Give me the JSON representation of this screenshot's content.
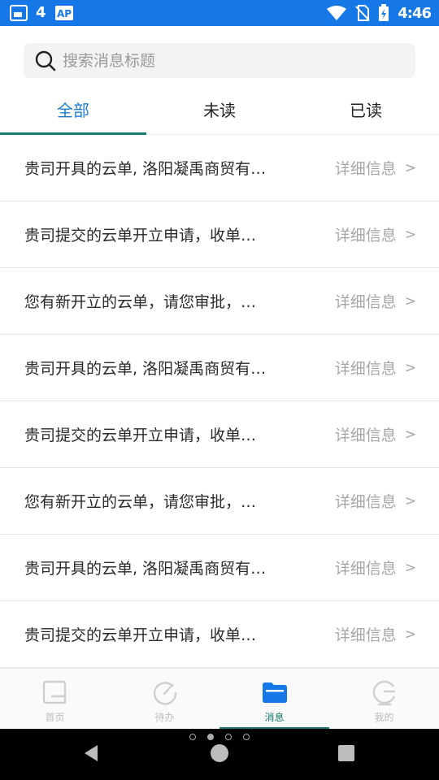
{
  "status_bar": {
    "left_number": "4",
    "time": "4:46"
  },
  "search": {
    "placeholder": "搜索消息标题"
  },
  "tabs": [
    {
      "label": "全部",
      "active": true
    },
    {
      "label": "未读",
      "active": false
    },
    {
      "label": "已读",
      "active": false
    }
  ],
  "messages": [
    {
      "title": "贵司开具的云单, 洛阳凝禹商贸有…",
      "detail": "详细信息"
    },
    {
      "title": "贵司提交的云单开立申请，收单…",
      "detail": "详细信息"
    },
    {
      "title": "您有新开立的云单，请您审批，…",
      "detail": "详细信息"
    },
    {
      "title": "贵司开具的云单, 洛阳凝禹商贸有…",
      "detail": "详细信息"
    },
    {
      "title": "贵司提交的云单开立申请，收单…",
      "detail": "详细信息"
    },
    {
      "title": "您有新开立的云单，请您审批，…",
      "detail": "详细信息"
    },
    {
      "title": "贵司开具的云单, 洛阳凝禹商贸有…",
      "detail": "详细信息"
    },
    {
      "title": "贵司提交的云单开立申请，收单…",
      "detail": "详细信息"
    }
  ],
  "chevron": ">",
  "bottom_nav": [
    {
      "label": "首页",
      "icon": "home-icon"
    },
    {
      "label": "待办",
      "icon": "todo-icon"
    },
    {
      "label": "消息",
      "icon": "folder-icon",
      "active": true
    },
    {
      "label": "我的",
      "icon": "profile-icon"
    }
  ],
  "colors": {
    "status_bar": "#1677e6",
    "accent_teal": "#157a6e",
    "tab_active_text": "#1a7fd0",
    "nav_active_icon": "#1677e6"
  }
}
